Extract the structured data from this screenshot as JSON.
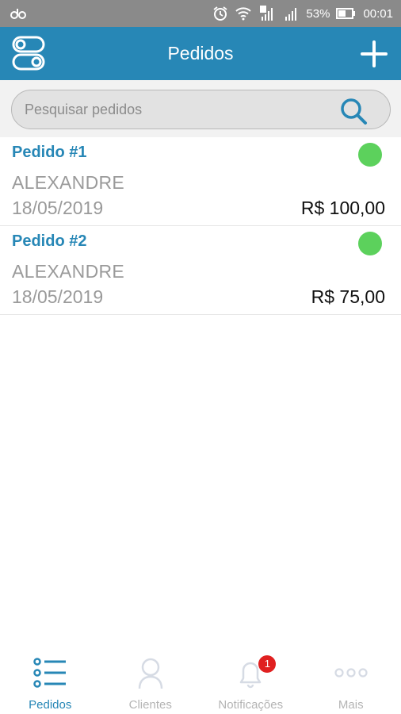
{
  "status_bar": {
    "battery": "53%",
    "time": "00:01",
    "icons": [
      "notification-icon",
      "alarm-icon",
      "wifi-icon",
      "signal-icon",
      "signal-icon",
      "battery-icon"
    ]
  },
  "header": {
    "title": "Pedidos",
    "left_icon": "toggle-icon",
    "right_icon": "plus-icon"
  },
  "search": {
    "placeholder": "Pesquisar pedidos",
    "value": "",
    "icon": "search-icon"
  },
  "orders": [
    {
      "title": "Pedido #1",
      "client": "ALEXANDRE",
      "date": "18/05/2019",
      "amount": "R$ 100,00",
      "status_color": "#5cd15c"
    },
    {
      "title": "Pedido #2",
      "client": "ALEXANDRE",
      "date": "18/05/2019",
      "amount": "R$ 75,00",
      "status_color": "#5cd15c"
    }
  ],
  "bottom_nav": {
    "items": [
      {
        "label": "Pedidos",
        "icon": "list-icon",
        "active": true
      },
      {
        "label": "Clientes",
        "icon": "person-icon",
        "active": false
      },
      {
        "label": "Notificações",
        "icon": "bell-icon",
        "active": false,
        "badge": "1"
      },
      {
        "label": "Mais",
        "icon": "more-icon",
        "active": false
      }
    ]
  },
  "colors": {
    "primary": "#2787b6",
    "status_ok": "#5cd15c",
    "badge": "#e02020",
    "status_bar": "#8a8a8a"
  }
}
